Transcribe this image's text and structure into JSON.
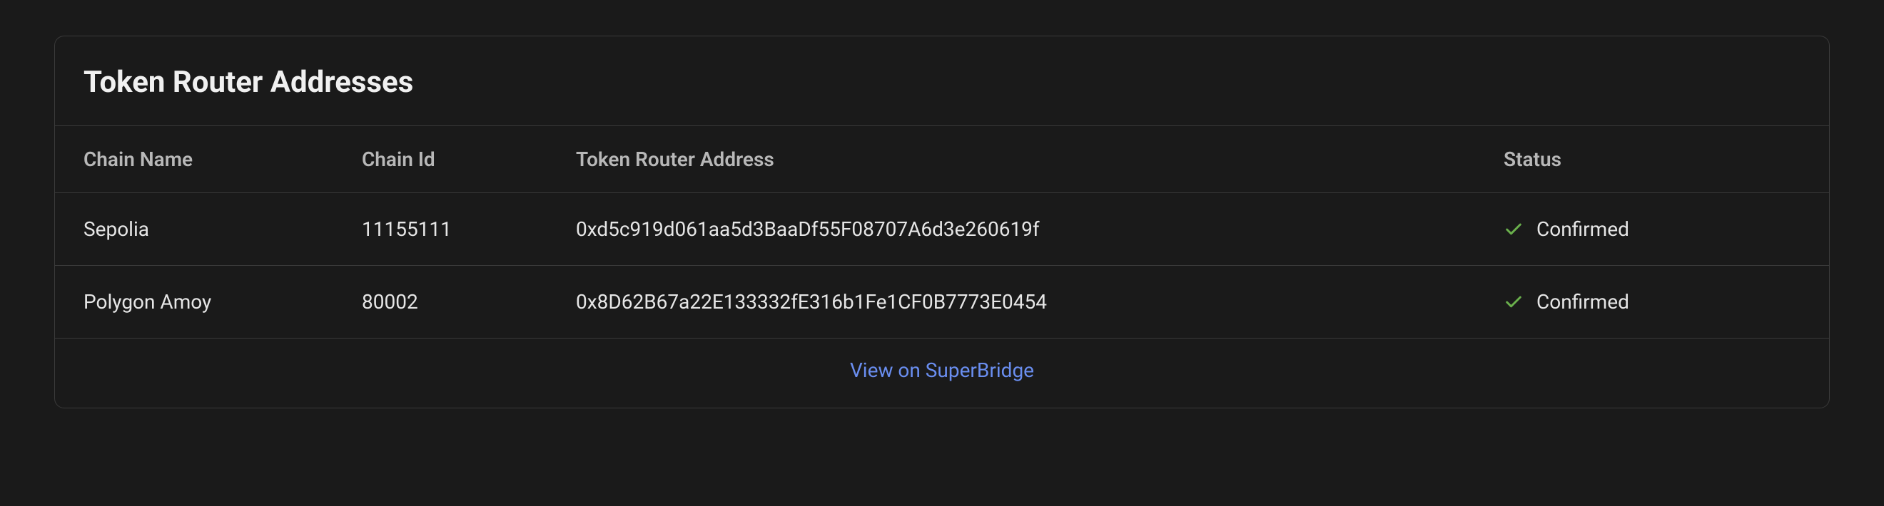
{
  "card_title": "Token Router Addresses",
  "table": {
    "headers": {
      "chain_name": "Chain Name",
      "chain_id": "Chain Id",
      "address": "Token Router Address",
      "status": "Status"
    },
    "rows": [
      {
        "chain_name": "Sepolia",
        "chain_id": "11155111",
        "address": "0xd5c919d061aa5d3BaaDf55F08707A6d3e260619f",
        "status": "Confirmed"
      },
      {
        "chain_name": "Polygon Amoy",
        "chain_id": "80002",
        "address": "0x8D62B67a22E133332fE316b1Fe1CF0B7773E0454",
        "status": "Confirmed"
      }
    ]
  },
  "footer_link_label": "View on SuperBridge"
}
